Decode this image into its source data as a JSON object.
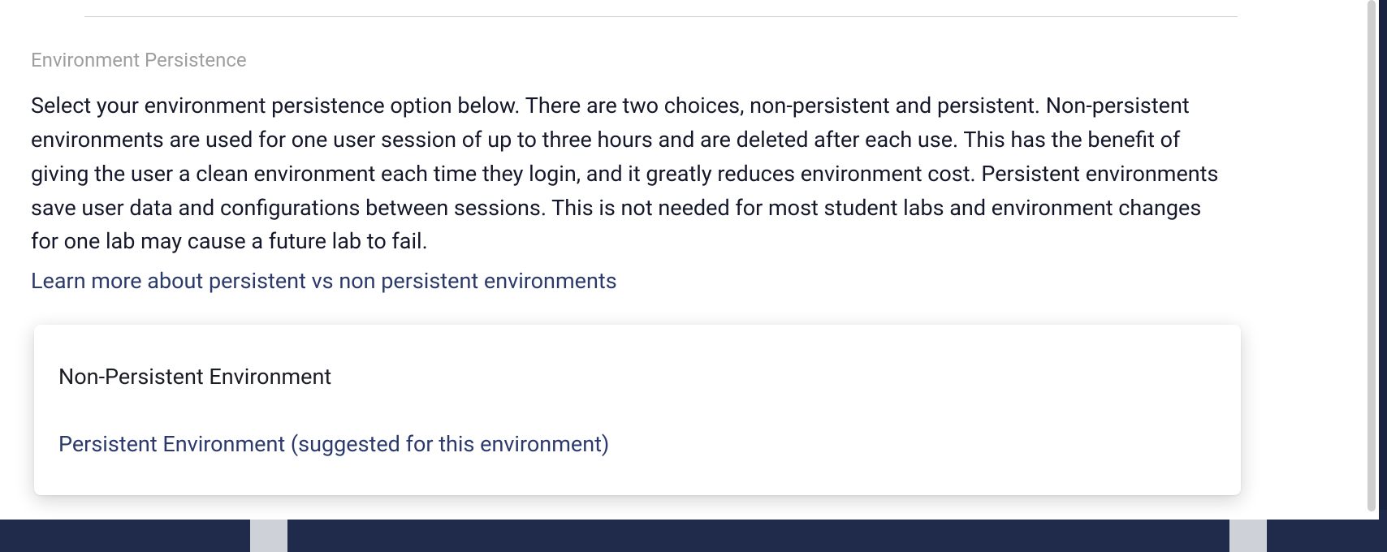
{
  "section": {
    "label": "Environment Persistence",
    "description": "Select your environment persistence option below. There are two choices, non-persistent and persistent. Non-persistent environments are used for one user session of up to three hours and are deleted after each use. This has the benefit of giving the user a clean environment each time they login, and it greatly reduces environment cost. Persistent environments save user data and configurations between sessions. This is not needed for most student labs and environment changes for one lab may cause a future lab to fail.",
    "learn_more": "Learn more about persistent vs non persistent environments"
  },
  "options": {
    "non_persistent": "Non-Persistent Environment",
    "persistent": "Persistent Environment (suggested for this environment)"
  }
}
